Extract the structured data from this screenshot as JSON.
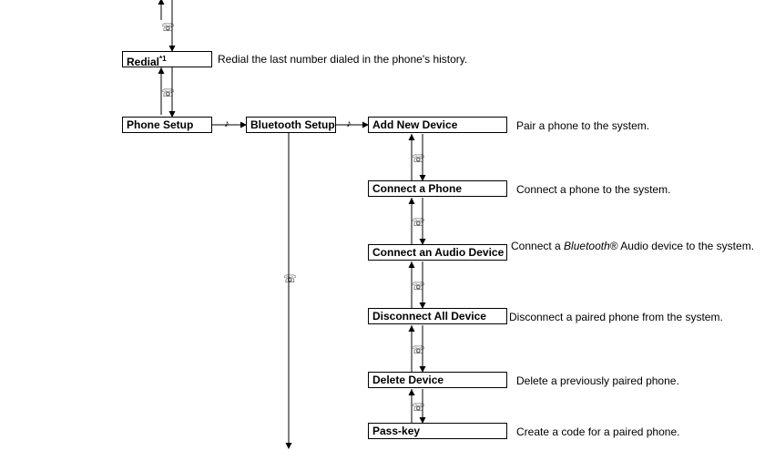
{
  "nodes": {
    "redial": {
      "label": "Redial",
      "sup": "*1"
    },
    "phone_setup": {
      "label": "Phone Setup"
    },
    "bluetooth_setup": {
      "label": "Bluetooth Setup"
    },
    "add_new_device": {
      "label": "Add New Device"
    },
    "connect_phone": {
      "label": "Connect a Phone"
    },
    "connect_audio": {
      "label": "Connect an Audio Device"
    },
    "disconnect_all": {
      "label": "Disconnect All Device"
    },
    "delete_device": {
      "label": "Delete Device"
    },
    "pass_key": {
      "label": "Pass-key"
    }
  },
  "descriptions": {
    "redial": "Redial the last number dialed in the phone's history.",
    "add_new_device": "Pair a phone to the system.",
    "connect_phone": "Connect a phone to the system.",
    "connect_audio_pre": "Connect a ",
    "connect_audio_brand": "Bluetooth",
    "connect_audio_post": "® Audio device to the system.",
    "disconnect_all": "Disconnect a paired phone from the system.",
    "delete_device": "Delete a previously paired phone.",
    "pass_key": "Create a code for a paired phone."
  },
  "icons": {
    "talk": "☏",
    "back": "♪"
  }
}
